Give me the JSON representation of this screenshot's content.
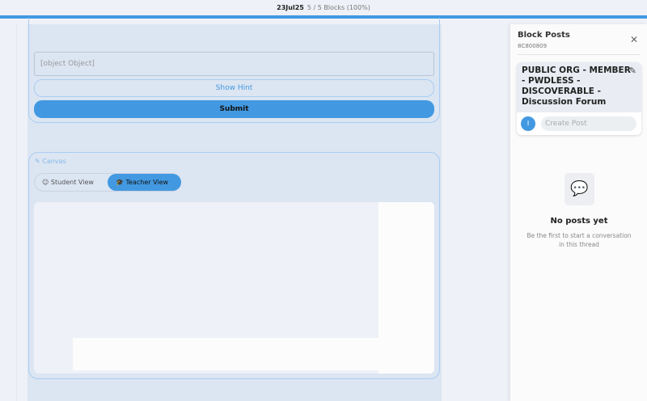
{
  "header": {
    "title": "23Jul25",
    "progress_text": "5 / 5 Blocks (100%)",
    "progress": 1.0
  },
  "question": {
    "input_value": "[object Object]",
    "hint_label": "Show Hint",
    "submit_label": "Submit"
  },
  "canvas": {
    "label": "Canvas",
    "student_view": "Student View",
    "teacher_view": "Teacher View",
    "active_view": "Teacher View"
  },
  "panel": {
    "title": "Block Posts",
    "id": "8C800809",
    "forum_title": "PUBLIC ORG - MEMBER - PWDLESS - DISCOVERABLE - Discussion Forum",
    "avatar_initial": "I",
    "create_post_placeholder": "Create Post",
    "empty_title": "No posts yet",
    "empty_subtitle": "Be the first to start a conversation in this thread"
  },
  "colors": {
    "accent": "#4299e1"
  }
}
